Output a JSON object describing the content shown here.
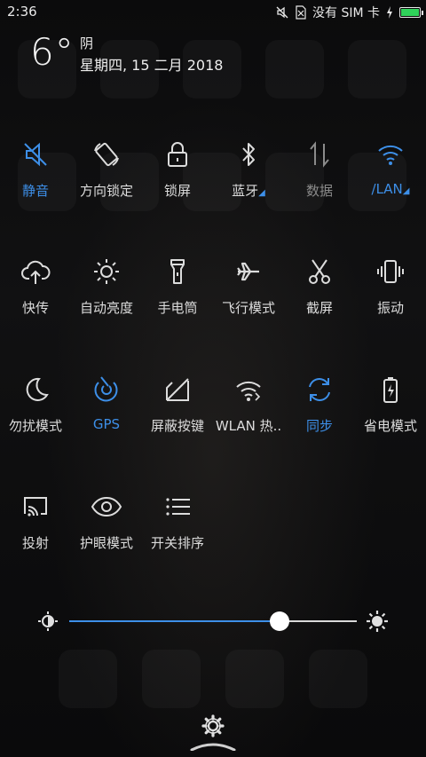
{
  "status_bar": {
    "time": "2:36",
    "carrier": "没有 SIM 卡",
    "icons": [
      "mute-icon",
      "no-sim-icon",
      "charging-icon",
      "battery-icon"
    ],
    "battery_level": 1.0,
    "battery_color": "#2fd25a"
  },
  "weather": {
    "temperature": "6°",
    "condition": "阴",
    "date": "星期四, 15 二月 2018"
  },
  "toggles": [
    {
      "label": "静音",
      "icon": "mute-icon",
      "state": "on"
    },
    {
      "label": "方向锁定",
      "icon": "rotation-lock-icon",
      "state": "off"
    },
    {
      "label": "锁屏",
      "icon": "lock-icon",
      "state": "off"
    },
    {
      "label": "蓝牙",
      "icon": "bluetooth-icon",
      "state": "off"
    },
    {
      "label": "数据",
      "icon": "data-icon",
      "state": "disabled"
    },
    {
      "label": "/LAN",
      "icon": "wifi-icon",
      "state": "on"
    },
    {
      "label": "快传",
      "icon": "cloud-upload-icon",
      "state": "off"
    },
    {
      "label": "自动亮度",
      "icon": "auto-brightness-icon",
      "state": "off"
    },
    {
      "label": "手电筒",
      "icon": "flashlight-icon",
      "state": "off"
    },
    {
      "label": "飞行模式",
      "icon": "airplane-icon",
      "state": "off"
    },
    {
      "label": "截屏",
      "icon": "scissors-icon",
      "state": "off"
    },
    {
      "label": "振动",
      "icon": "vibrate-icon",
      "state": "off"
    },
    {
      "label": "勿扰模式",
      "icon": "moon-icon",
      "state": "off"
    },
    {
      "label": "GPS",
      "icon": "gps-icon",
      "state": "on"
    },
    {
      "label": "屏蔽按键",
      "icon": "disable-keys-icon",
      "state": "off"
    },
    {
      "label": "WLAN 热..",
      "icon": "hotspot-icon",
      "state": "off"
    },
    {
      "label": "同步",
      "icon": "sync-icon",
      "state": "on"
    },
    {
      "label": "省电模式",
      "icon": "battery-saver-icon",
      "state": "off"
    },
    {
      "label": "投射",
      "icon": "cast-icon",
      "state": "off"
    },
    {
      "label": "护眼模式",
      "icon": "eye-icon",
      "state": "off"
    },
    {
      "label": "开关排序",
      "icon": "list-icon",
      "state": "off"
    }
  ],
  "brightness": {
    "level": 0.73,
    "low_icon": "brightness-low-icon",
    "high_icon": "brightness-high-icon"
  },
  "colors": {
    "accent": "#3d8fe8",
    "text": "#dcdcdc",
    "disabled": "#8b8b8b",
    "background": "#0a0a0b"
  },
  "footer": {
    "settings_icon": "gear-icon",
    "handle_icon": "pull-handle-icon"
  }
}
